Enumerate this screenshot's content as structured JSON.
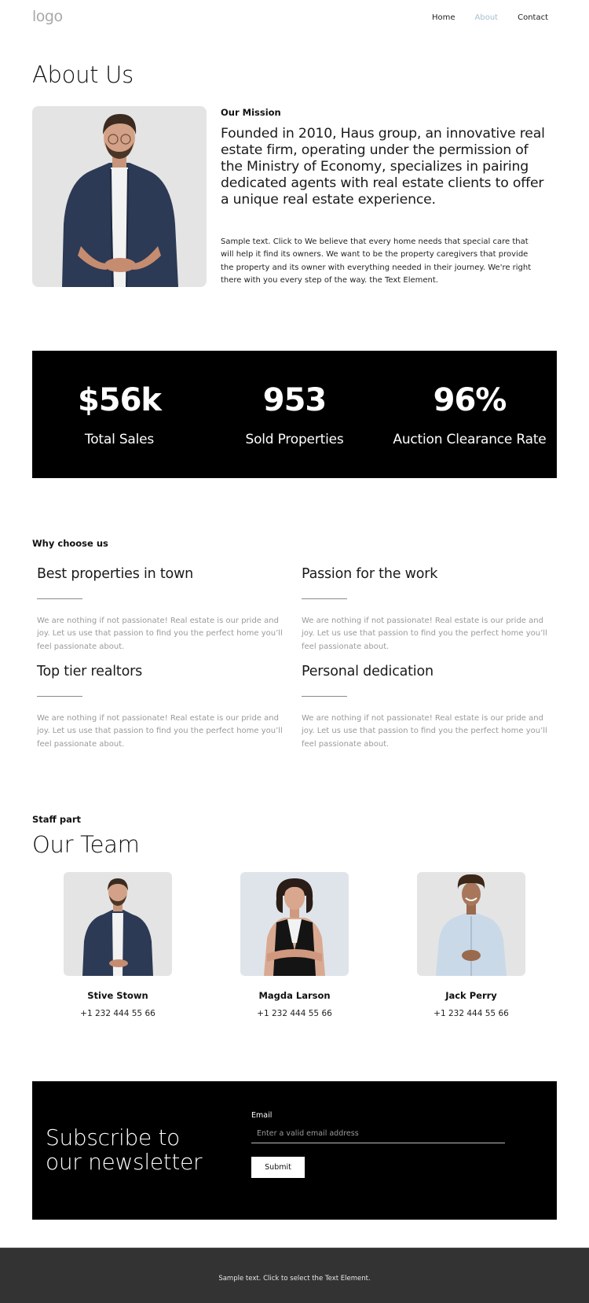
{
  "header": {
    "logo": "logo",
    "nav": [
      {
        "label": "Home",
        "active": false
      },
      {
        "label": "About",
        "active": true
      },
      {
        "label": "Contact",
        "active": false
      }
    ],
    "active_color": "#a7c0d2"
  },
  "page_title": "About Us",
  "mission": {
    "photo": "man-in-navy-shirt-photo",
    "label": "Our Mission",
    "lead": "Founded in 2010, Haus group, an innovative real estate firm, operating under the permission of the Ministry of Economy, specializes in pairing dedicated agents with real estate clients to offer a unique real estate experience.",
    "body": "Sample text. Click to We believe that every home needs that special care that will help it find its owners. We want to be the property caregivers that provide the property and its owner with everything needed in their journey. We're right there with you every step of the way. the Text Element."
  },
  "stats": [
    {
      "value": "$56k",
      "label": "Total Sales"
    },
    {
      "value": "953",
      "label": "Sold Properties"
    },
    {
      "value": "96%",
      "label": "Auction Clearance Rate"
    }
  ],
  "why": {
    "label": "Why choose us",
    "features": [
      {
        "title": "Best properties in town",
        "text": "We are nothing if not passionate! Real estate is our pride and joy. Let us use that passion to find you the perfect home you’ll feel passionate about."
      },
      {
        "title": "Passion for the work",
        "text": "We are nothing if not passionate! Real estate is our pride and joy. Let us use that passion to find you the perfect home you’ll feel passionate about."
      },
      {
        "title": "Top tier realtors",
        "text": "We are nothing if not passionate! Real estate is our pride and joy. Let us use that passion to find you the perfect home you’ll feel passionate about."
      },
      {
        "title": "Personal dedication",
        "text": "We are nothing if not passionate! Real estate is our pride and joy. Let us use that passion to find you the perfect home you’ll feel passionate about."
      }
    ]
  },
  "team": {
    "label": "Staff part",
    "title": "Our Team",
    "members": [
      {
        "name": "Stive Stown",
        "phone": "+1 232 444 55 66"
      },
      {
        "name": "Magda Larson",
        "phone": "+1 232 444 55 66"
      },
      {
        "name": "Jack Perry",
        "phone": "+1 232 444 55 66"
      }
    ]
  },
  "subscribe": {
    "title_line1": "Subscribe to",
    "title_line2": "our newsletter",
    "email_label": "Email",
    "email_value": "",
    "email_placeholder": "Enter a valid email address",
    "submit_label": "Submit"
  },
  "footer": {
    "text": "Sample text. Click to select the Text Element."
  }
}
